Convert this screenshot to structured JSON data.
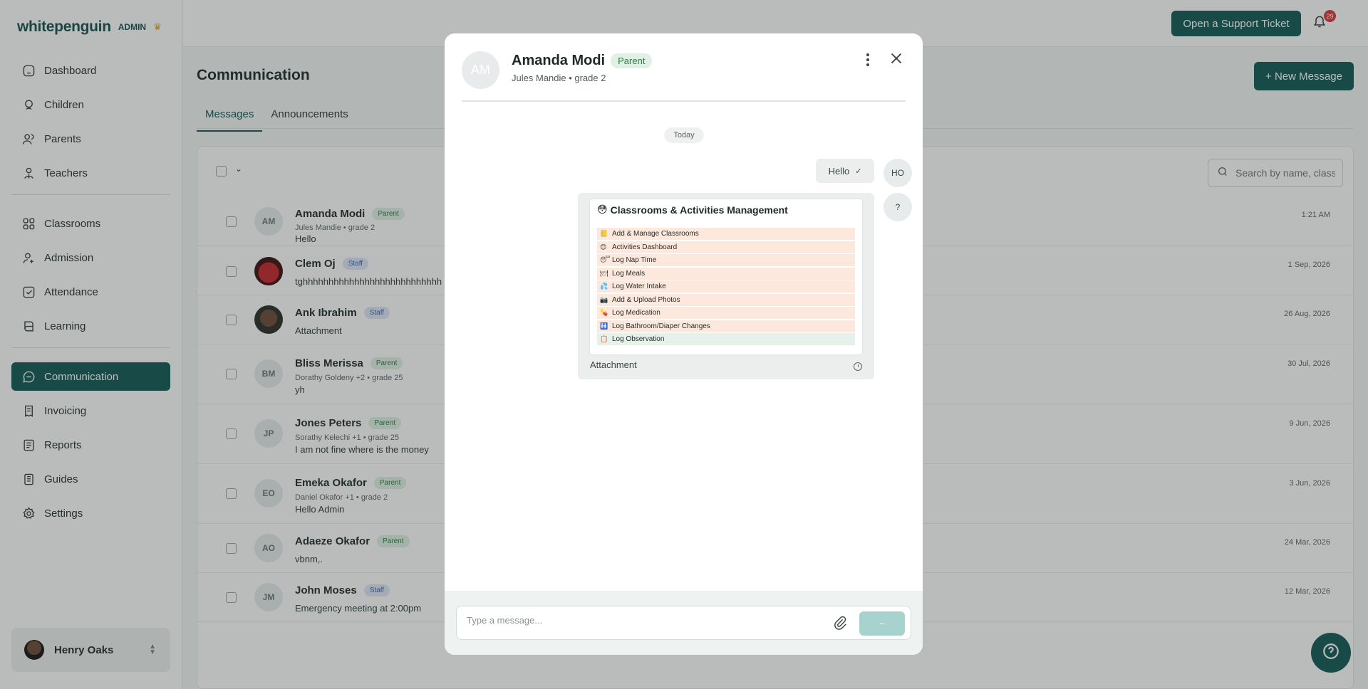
{
  "brand": {
    "name": "whitepenguin",
    "role": "ADMIN",
    "crown_icon": "crown-icon"
  },
  "sidebar": {
    "items": [
      {
        "label": "Dashboard",
        "icon": "home-icon"
      },
      {
        "label": "Children",
        "icon": "child-icon"
      },
      {
        "label": "Parents",
        "icon": "users-icon"
      },
      {
        "label": "Teachers",
        "icon": "teacher-icon"
      },
      {
        "label": "Classrooms",
        "icon": "grid-icon"
      },
      {
        "label": "Admission",
        "icon": "user-plus-icon"
      },
      {
        "label": "Attendance",
        "icon": "check-square-icon"
      },
      {
        "label": "Learning",
        "icon": "book-icon"
      },
      {
        "label": "Communication",
        "icon": "chat-icon",
        "active": true
      },
      {
        "label": "Invoicing",
        "icon": "invoice-icon"
      },
      {
        "label": "Reports",
        "icon": "report-icon"
      },
      {
        "label": "Guides",
        "icon": "guide-icon"
      },
      {
        "label": "Settings",
        "icon": "gear-icon"
      }
    ],
    "user": {
      "name": "Henry Oaks"
    }
  },
  "topbar": {
    "support_label": "Open a Support Ticket",
    "notification_count": "29"
  },
  "main": {
    "title": "Communication",
    "new_message_label": "+ New Message",
    "tabs": [
      {
        "label": "Messages",
        "active": true
      },
      {
        "label": "Announcements"
      }
    ],
    "search_placeholder": "Search by name, class, ...",
    "rows": [
      {
        "initials": "AM",
        "name": "Amanda Modi",
        "role": "Parent",
        "sub": "Jules Mandie • grade 2",
        "msg": "Hello",
        "date": "1:21 AM"
      },
      {
        "initials": "",
        "name": "Clem Oj",
        "role": "Staff",
        "sub": "",
        "msg": "tghhhhhhhhhhhhhhhhhhhhhhhhhhh",
        "date": "1 Sep, 2026"
      },
      {
        "initials": "",
        "name": "Ank Ibrahim",
        "role": "Staff",
        "sub": "",
        "msg": "Attachment",
        "date": "26 Aug, 2026"
      },
      {
        "initials": "BM",
        "name": "Bliss Merissa",
        "role": "Parent",
        "sub": "Dorathy Goldeny +2 • grade 25",
        "msg": "yh",
        "date": "30 Jul, 2026"
      },
      {
        "initials": "JP",
        "name": "Jones Peters",
        "role": "Parent",
        "sub": "Sorathy Kelechi +1 • grade 25",
        "msg": "I am not fine where is the money",
        "date": "9 Jun, 2026"
      },
      {
        "initials": "EO",
        "name": "Emeka Okafor",
        "role": "Parent",
        "sub": "Daniel Okafor +1 • grade 2",
        "msg": "Hello Admin",
        "date": "3 Jun, 2026"
      },
      {
        "initials": "AO",
        "name": "Adaeze Okafor",
        "role": "Parent",
        "sub": "",
        "msg": "vbnm,.",
        "date": "24 Mar, 2026"
      },
      {
        "initials": "JM",
        "name": "John Moses",
        "role": "Staff",
        "sub": "",
        "msg": "Emergency meeting at 2:00pm",
        "date": "12 Mar, 2026"
      }
    ]
  },
  "modal": {
    "initials": "AM",
    "name": "Amanda Modi",
    "role": "Parent",
    "sub": "Jules Mandie • grade 2",
    "day_label": "Today",
    "hello_text": "Hello",
    "avatar_ho": "HO",
    "avatar_q": "?",
    "attachment": {
      "title": "Classrooms & Activities Management",
      "items": [
        {
          "emoji": "📒",
          "label": "Add & Manage Classrooms"
        },
        {
          "emoji": "😊",
          "label": "Activities Dashboard"
        },
        {
          "emoji": "😴",
          "label": "Log Nap Time"
        },
        {
          "emoji": "🍽",
          "label": "Log Meals"
        },
        {
          "emoji": "💦",
          "label": "Log Water Intake"
        },
        {
          "emoji": "📷",
          "label": "Add & Upload Photos"
        },
        {
          "emoji": "💊",
          "label": "Log Medication"
        },
        {
          "emoji": "🚻",
          "label": "Log Bathroom/Diaper Changes"
        },
        {
          "emoji": "📋",
          "label": "Log Observation"
        }
      ],
      "label": "Attachment"
    },
    "input_placeholder": "Type a message...",
    "send_label": "–"
  },
  "colors": {
    "brand": "#115955",
    "parent_badge": "#dff1e4",
    "staff_badge": "#dde8f6",
    "notification": "#d83a3a"
  }
}
